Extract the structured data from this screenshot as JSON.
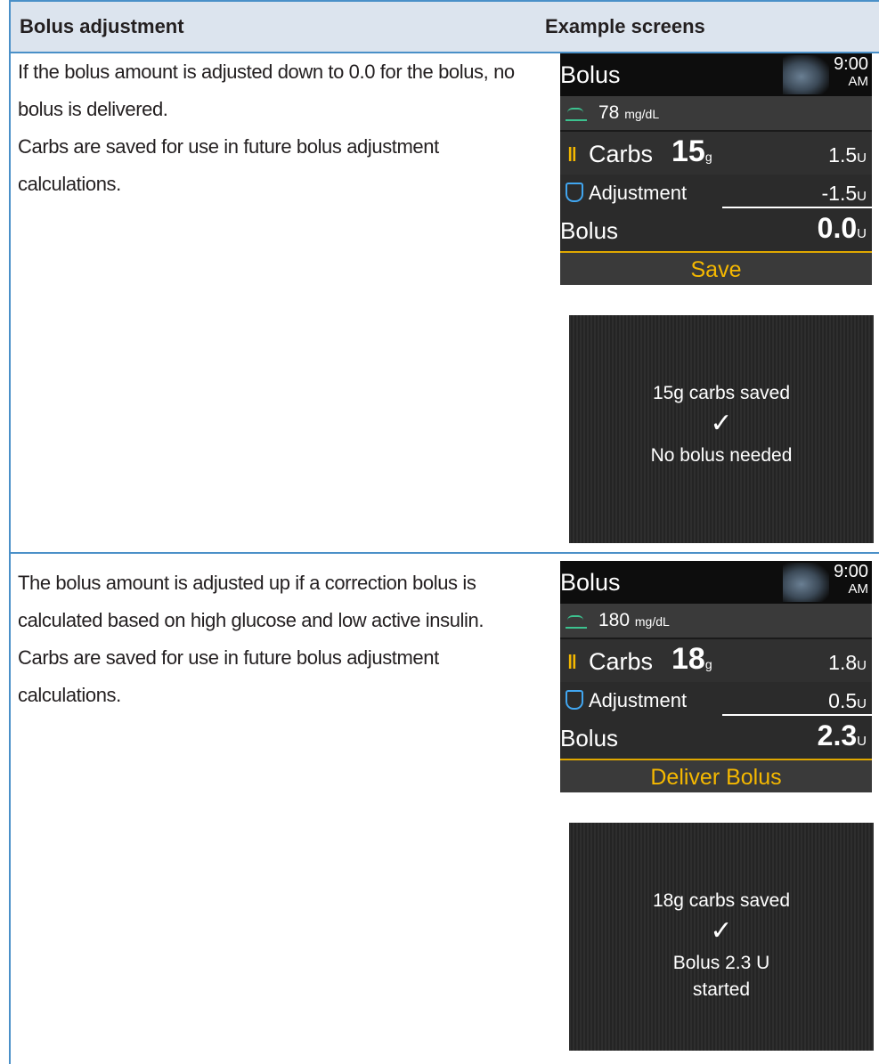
{
  "header": {
    "col1": "Bolus adjustment",
    "col2": "Example screens"
  },
  "rows": [
    {
      "paragraphs": [
        "If the bolus amount is adjusted down to 0.0 for the bolus, no bolus is delivered.",
        "Carbs are saved for use in future bolus adjustment calculations."
      ],
      "screen": {
        "title": "Bolus",
        "time": "9:00",
        "ampm": "AM",
        "glucose_value": "78",
        "glucose_unit": "mg/dL",
        "carbs_label": "Carbs",
        "carbs_value": "15",
        "carbs_unit": "g",
        "carbs_insulin": "1.5",
        "unit_u": "U",
        "adjustment_label": "Adjustment",
        "adjustment_value": "-1.5",
        "bolus_label": "Bolus",
        "bolus_value": "0.0",
        "action_label": "Save"
      },
      "confirm": {
        "line1": "15g carbs saved",
        "check": "✓",
        "line2": "No bolus needed"
      }
    },
    {
      "paragraphs": [
        "The bolus amount is adjusted up if a correction bolus is calculated based on high glucose and low active insulin.",
        "Carbs are saved for use in future bolus adjustment calculations."
      ],
      "screen": {
        "title": "Bolus",
        "time": "9:00",
        "ampm": "AM",
        "glucose_value": "180",
        "glucose_unit": "mg/dL",
        "carbs_label": "Carbs",
        "carbs_value": "18",
        "carbs_unit": "g",
        "carbs_insulin": "1.8",
        "unit_u": "U",
        "adjustment_label": "Adjustment",
        "adjustment_value": "0.5",
        "bolus_label": "Bolus",
        "bolus_value": "2.3",
        "action_label": "Deliver Bolus"
      },
      "confirm": {
        "line1": "18g carbs saved",
        "check": "✓",
        "line2a": "Bolus 2.3 U",
        "line2b": "started"
      }
    }
  ],
  "colors": {
    "rule": "#4a90c8",
    "header_bg": "#dce4ee",
    "accent": "#f5b800",
    "glucose_icon": "#3cc28f",
    "shield_icon": "#41a6f0"
  }
}
